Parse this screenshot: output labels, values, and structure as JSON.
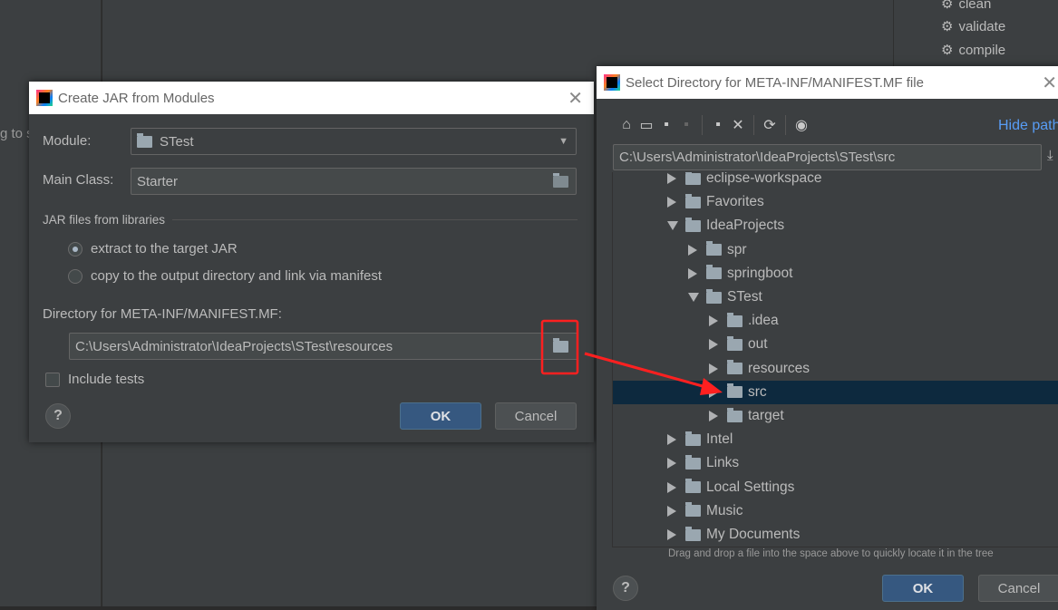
{
  "background": {
    "left_text": "g to s",
    "maven_items": [
      "clean",
      "validate",
      "compile"
    ]
  },
  "jar_dialog": {
    "title": "Create JAR from Modules",
    "module_label": "Module:",
    "module_value": "STest",
    "main_class_label": "Main Class:",
    "main_class_value": "Starter",
    "libraries_group": "JAR files from libraries",
    "radio_options": [
      {
        "label": "extract to the target JAR",
        "selected": true
      },
      {
        "label": "copy to the output directory and link via manifest",
        "selected": false
      }
    ],
    "manifest_label": "Directory for META-INF/MANIFEST.MF:",
    "manifest_value": "C:\\Users\\Administrator\\IdeaProjects\\STest\\resources",
    "include_tests_label": "Include tests",
    "include_tests_checked": false,
    "ok": "OK",
    "cancel": "Cancel",
    "help": "?"
  },
  "dir_dialog": {
    "title": "Select Directory for META-INF/MANIFEST.MF file",
    "hide_path": "Hide path",
    "path_value": "C:\\Users\\Administrator\\IdeaProjects\\STest\\src",
    "toolbar_icons": [
      "home-icon",
      "desktop-icon",
      "project-folder-icon",
      "module-folder-icon",
      "new-folder-icon",
      "delete-icon",
      "refresh-icon",
      "show-hidden-icon"
    ],
    "tree": [
      {
        "label": "eclipse-workspace",
        "level": 0,
        "expanded": false
      },
      {
        "label": "Favorites",
        "level": 0,
        "expanded": false
      },
      {
        "label": "IdeaProjects",
        "level": 0,
        "expanded": true
      },
      {
        "label": "spr",
        "level": 1,
        "expanded": false
      },
      {
        "label": "springboot",
        "level": 1,
        "expanded": false
      },
      {
        "label": "STest",
        "level": 1,
        "expanded": true
      },
      {
        "label": ".idea",
        "level": 2,
        "expanded": false
      },
      {
        "label": "out",
        "level": 2,
        "expanded": false
      },
      {
        "label": "resources",
        "level": 2,
        "expanded": false
      },
      {
        "label": "src",
        "level": 2,
        "expanded": false,
        "selected": true
      },
      {
        "label": "target",
        "level": 2,
        "expanded": false
      },
      {
        "label": "Intel",
        "level": 0,
        "expanded": false
      },
      {
        "label": "Links",
        "level": 0,
        "expanded": false
      },
      {
        "label": "Local Settings",
        "level": 0,
        "expanded": false,
        "link": true
      },
      {
        "label": "Music",
        "level": 0,
        "expanded": false
      },
      {
        "label": "My Documents",
        "level": 0,
        "expanded": false,
        "link": true
      }
    ],
    "hint": "Drag and drop a file into the space above to quickly locate it in the tree",
    "ok": "OK",
    "cancel": "Cancel",
    "help": "?"
  },
  "colors": {
    "accent": "#365880",
    "selection": "#0d293e",
    "annotation": "#ff2020",
    "link": "#589df6"
  }
}
